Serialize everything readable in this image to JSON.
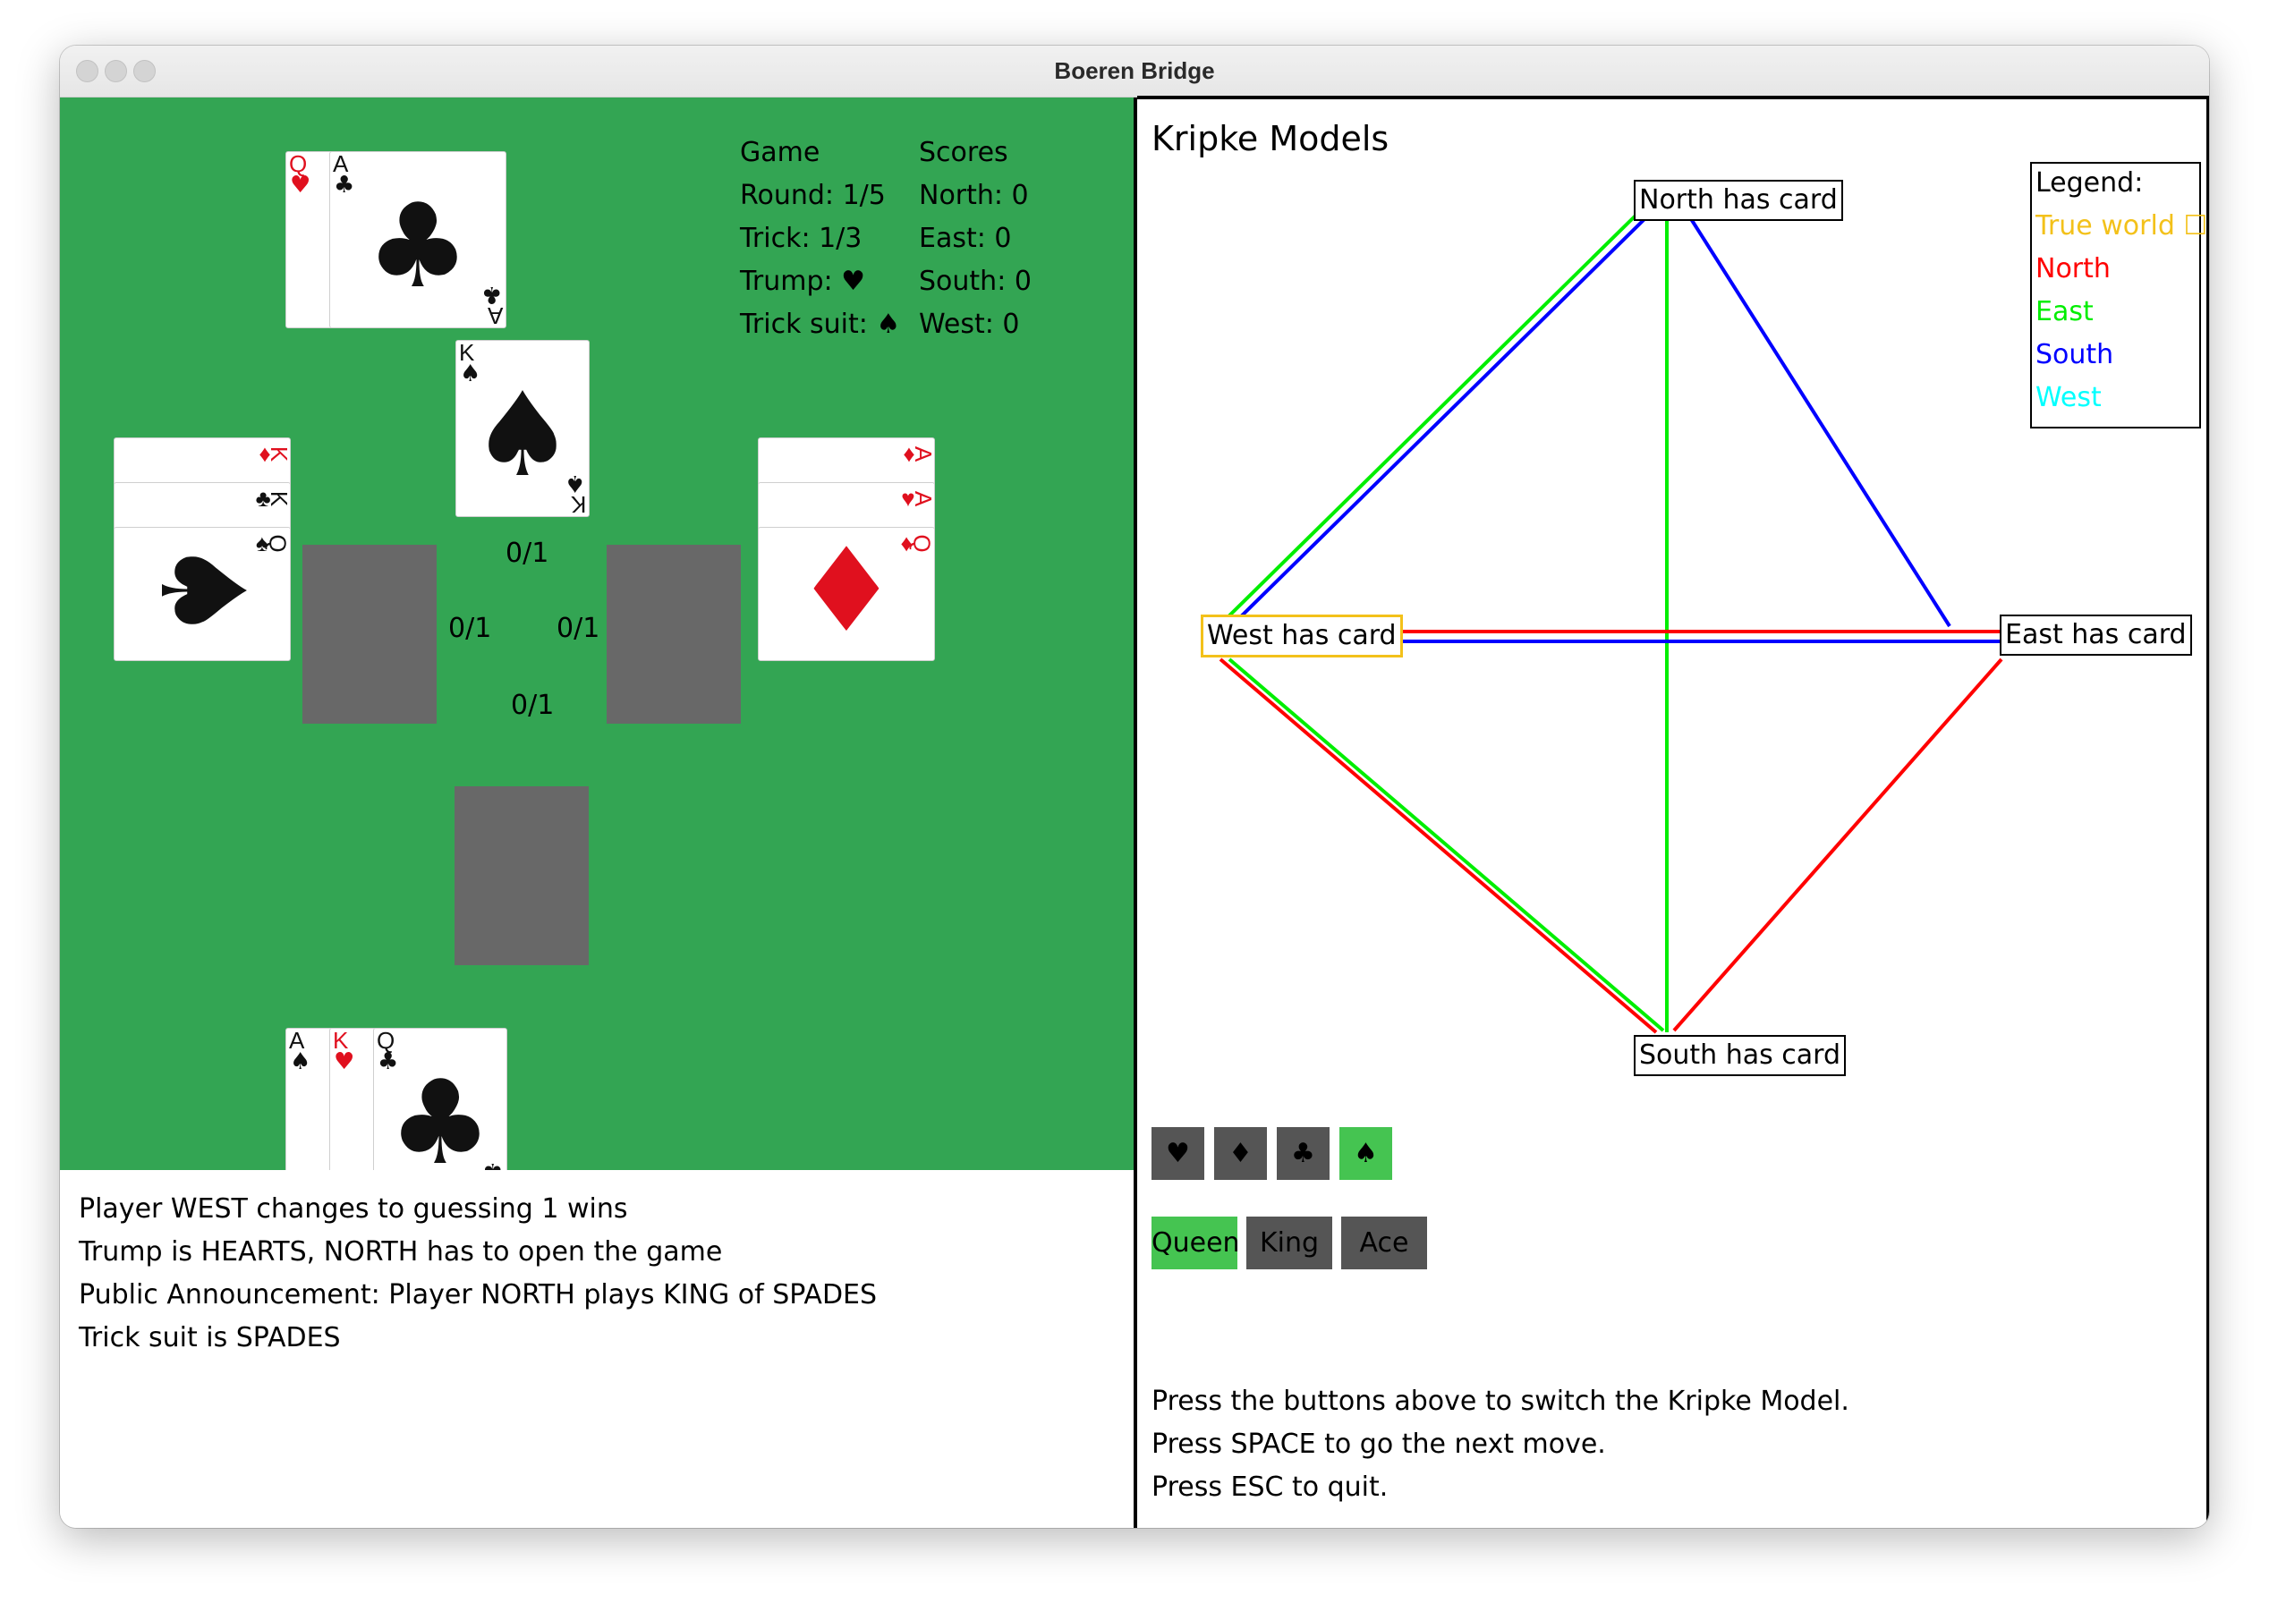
{
  "window": {
    "title": "Boeren Bridge"
  },
  "game_info": {
    "game_header": "Game",
    "round": "Round: 1/5",
    "trick": "Trick: 1/3",
    "trump": "Trump: ♥",
    "trick_suit": "Trick suit: ♠",
    "scores_header": "Scores",
    "scores": [
      "North: 0",
      "East: 0",
      "South: 0",
      "West: 0"
    ]
  },
  "hands": {
    "north": [
      {
        "rank": "Q",
        "suit": "♥",
        "color": "#e0101e"
      },
      {
        "rank": "A",
        "suit": "♣",
        "color": "#111111"
      }
    ],
    "west": [
      {
        "rank": "K",
        "suit": "♦",
        "color": "#e0101e"
      },
      {
        "rank": "K",
        "suit": "♣",
        "color": "#111111"
      },
      {
        "rank": "Q",
        "suit": "♠",
        "color": "#111111"
      }
    ],
    "east": [
      {
        "rank": "A",
        "suit": "♦",
        "color": "#e0101e"
      },
      {
        "rank": "A",
        "suit": "♥",
        "color": "#e0101e"
      },
      {
        "rank": "Q",
        "suit": "♦",
        "color": "#e0101e"
      }
    ],
    "south": [
      {
        "rank": "A",
        "suit": "♠",
        "color": "#111111"
      },
      {
        "rank": "K",
        "suit": "♥",
        "color": "#e0101e"
      },
      {
        "rank": "Q",
        "suit": "♣",
        "color": "#111111"
      }
    ]
  },
  "played_card": {
    "rank": "K",
    "suit": "♠",
    "color": "#111111"
  },
  "bids": {
    "north": "0/1",
    "west": "0/1",
    "east": "0/1",
    "south": "0/1"
  },
  "log": [
    "Player WEST changes to guessing 1 wins",
    "Trump is HEARTS, NORTH has to open the game",
    "Public Announcement: Player NORTH plays KING of SPADES",
    "Trick suit is SPADES"
  ],
  "kripke": {
    "title": "Kripke Models",
    "nodes": {
      "north": "North has card",
      "west": "West has card",
      "east": "East has card",
      "south": "South has card"
    },
    "true_world": "west",
    "legend": {
      "title": "Legend:",
      "items": [
        {
          "label": "True world ☐",
          "color": "#f3c11a"
        },
        {
          "label": "North",
          "color": "#ff0000"
        },
        {
          "label": "East",
          "color": "#00ee00"
        },
        {
          "label": "South",
          "color": "#0000ff"
        },
        {
          "label": "West",
          "color": "#00ffff"
        }
      ]
    },
    "suit_buttons": [
      "♥",
      "♦",
      "♣",
      "♠"
    ],
    "active_suit": "♠",
    "rank_buttons": [
      "Queen",
      "King",
      "Ace"
    ],
    "active_rank": "Queen",
    "instructions": [
      "Press the buttons above to switch the Kripke Model.",
      "Press SPACE to go the next move.",
      "Press ESC to quit."
    ]
  }
}
